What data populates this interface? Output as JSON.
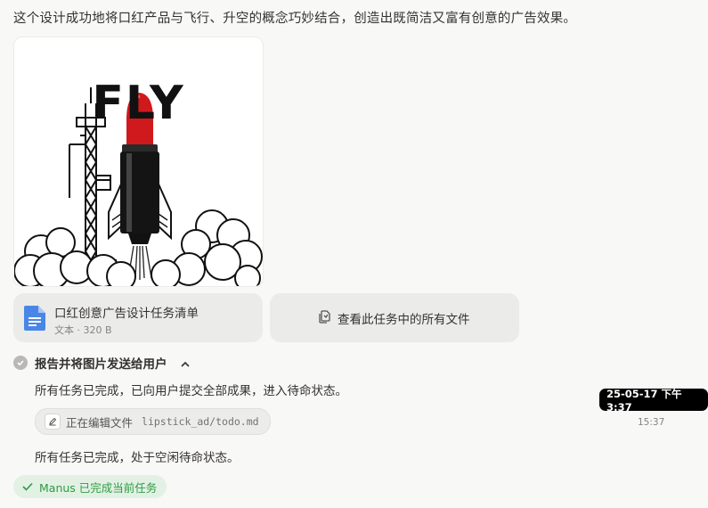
{
  "message": {
    "intro": "这个设计成功地将口红产品与飞行、升空的概念巧妙结合，创造出既简洁又富有创意的广告效果。"
  },
  "image": {
    "title_text": "FLY"
  },
  "attachment": {
    "file_name": "口红创意广告设计任务清单",
    "file_meta": "文本 · 320 B",
    "icon": "document-icon"
  },
  "view_all": {
    "label": "查看此任务中的所有文件",
    "icon": "files-icon"
  },
  "step": {
    "title": "报告并将图片发送给用户",
    "description": "所有任务已完成，已向用户提交全部成果，进入待命状态。",
    "tool": {
      "action": "正在编辑文件",
      "path": "lipstick_ad/todo.md"
    }
  },
  "status_text": "所有任务已完成，处于空闲待命状态。",
  "completed_badge": "Manus 已完成当前任务",
  "tooltip": "25-05-17 下午 3:37",
  "timestamp": "15:37",
  "colors": {
    "lipstick": "#d0191c",
    "doc_icon": "#4a86e8",
    "success": "#2f9a45"
  }
}
